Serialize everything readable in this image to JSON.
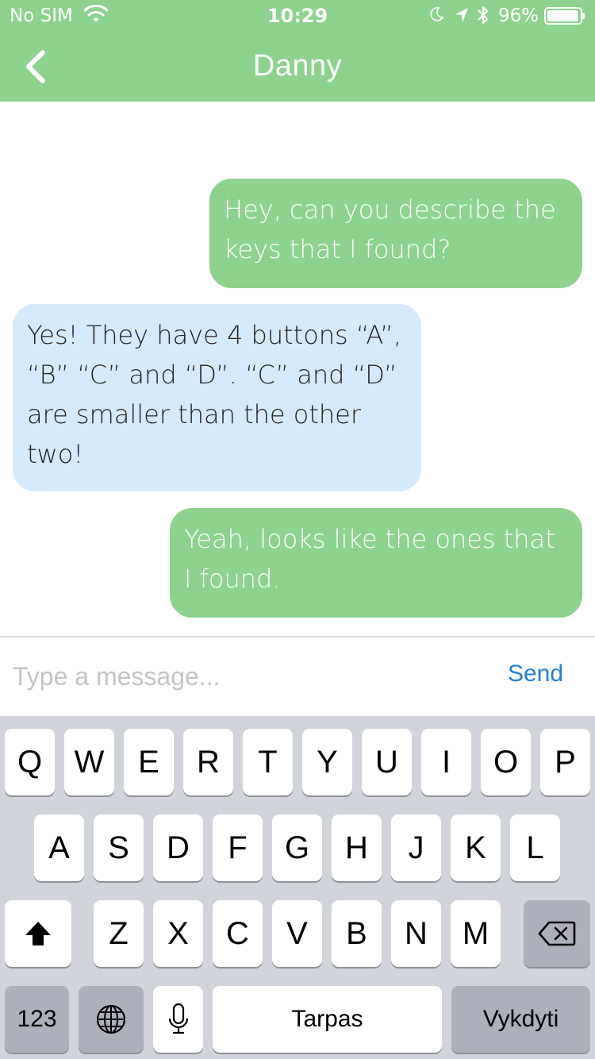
{
  "status_bar": {
    "carrier": "No SIM",
    "time": "10:29",
    "battery": "96%",
    "battery_level": 0.96
  },
  "header": {
    "title": "Danny",
    "back_icon": "chevron-left-icon",
    "background": "#8dd38e"
  },
  "messages": [
    {
      "from": "me",
      "text": "Hey, can you describe the keys that I found?"
    },
    {
      "from": "Danny",
      "text": "Yes! They have 4 buttons “A”, “B” “C” and “D”. “C” and “D” are smaller than the other two!"
    },
    {
      "from": "me",
      "text": "Yeah, looks like the ones that I found."
    }
  ],
  "composer": {
    "placeholder": "Type a message...",
    "value": "",
    "send_label": "Send"
  },
  "keyboard": {
    "row1": [
      "Q",
      "W",
      "E",
      "R",
      "T",
      "Y",
      "U",
      "I",
      "O",
      "P"
    ],
    "row2": [
      "A",
      "S",
      "D",
      "F",
      "G",
      "H",
      "J",
      "K",
      "L"
    ],
    "row3": [
      "Z",
      "X",
      "C",
      "V",
      "B",
      "N",
      "M"
    ],
    "numbers_label": "123",
    "space_label": "Tarpas",
    "return_label": "Vykdyti",
    "icons": [
      "shift-icon",
      "backspace-icon",
      "globe-icon",
      "microphone-icon"
    ]
  },
  "colors": {
    "outgoing_bubble": "#8dd38e",
    "incoming_bubble": "#d6eafd",
    "send": "#1f7fe0"
  }
}
